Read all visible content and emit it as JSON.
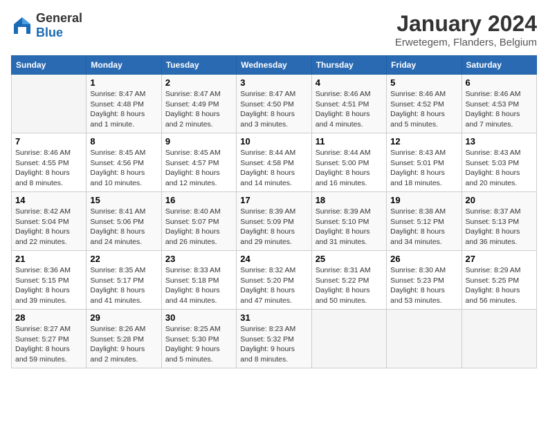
{
  "header": {
    "logo_general": "General",
    "logo_blue": "Blue",
    "month": "January 2024",
    "location": "Erwetegem, Flanders, Belgium"
  },
  "days_of_week": [
    "Sunday",
    "Monday",
    "Tuesday",
    "Wednesday",
    "Thursday",
    "Friday",
    "Saturday"
  ],
  "weeks": [
    [
      {
        "day": "",
        "info": ""
      },
      {
        "day": "1",
        "info": "Sunrise: 8:47 AM\nSunset: 4:48 PM\nDaylight: 8 hours\nand 1 minute."
      },
      {
        "day": "2",
        "info": "Sunrise: 8:47 AM\nSunset: 4:49 PM\nDaylight: 8 hours\nand 2 minutes."
      },
      {
        "day": "3",
        "info": "Sunrise: 8:47 AM\nSunset: 4:50 PM\nDaylight: 8 hours\nand 3 minutes."
      },
      {
        "day": "4",
        "info": "Sunrise: 8:46 AM\nSunset: 4:51 PM\nDaylight: 8 hours\nand 4 minutes."
      },
      {
        "day": "5",
        "info": "Sunrise: 8:46 AM\nSunset: 4:52 PM\nDaylight: 8 hours\nand 5 minutes."
      },
      {
        "day": "6",
        "info": "Sunrise: 8:46 AM\nSunset: 4:53 PM\nDaylight: 8 hours\nand 7 minutes."
      }
    ],
    [
      {
        "day": "7",
        "info": "Sunrise: 8:46 AM\nSunset: 4:55 PM\nDaylight: 8 hours\nand 8 minutes."
      },
      {
        "day": "8",
        "info": "Sunrise: 8:45 AM\nSunset: 4:56 PM\nDaylight: 8 hours\nand 10 minutes."
      },
      {
        "day": "9",
        "info": "Sunrise: 8:45 AM\nSunset: 4:57 PM\nDaylight: 8 hours\nand 12 minutes."
      },
      {
        "day": "10",
        "info": "Sunrise: 8:44 AM\nSunset: 4:58 PM\nDaylight: 8 hours\nand 14 minutes."
      },
      {
        "day": "11",
        "info": "Sunrise: 8:44 AM\nSunset: 5:00 PM\nDaylight: 8 hours\nand 16 minutes."
      },
      {
        "day": "12",
        "info": "Sunrise: 8:43 AM\nSunset: 5:01 PM\nDaylight: 8 hours\nand 18 minutes."
      },
      {
        "day": "13",
        "info": "Sunrise: 8:43 AM\nSunset: 5:03 PM\nDaylight: 8 hours\nand 20 minutes."
      }
    ],
    [
      {
        "day": "14",
        "info": "Sunrise: 8:42 AM\nSunset: 5:04 PM\nDaylight: 8 hours\nand 22 minutes."
      },
      {
        "day": "15",
        "info": "Sunrise: 8:41 AM\nSunset: 5:06 PM\nDaylight: 8 hours\nand 24 minutes."
      },
      {
        "day": "16",
        "info": "Sunrise: 8:40 AM\nSunset: 5:07 PM\nDaylight: 8 hours\nand 26 minutes."
      },
      {
        "day": "17",
        "info": "Sunrise: 8:39 AM\nSunset: 5:09 PM\nDaylight: 8 hours\nand 29 minutes."
      },
      {
        "day": "18",
        "info": "Sunrise: 8:39 AM\nSunset: 5:10 PM\nDaylight: 8 hours\nand 31 minutes."
      },
      {
        "day": "19",
        "info": "Sunrise: 8:38 AM\nSunset: 5:12 PM\nDaylight: 8 hours\nand 34 minutes."
      },
      {
        "day": "20",
        "info": "Sunrise: 8:37 AM\nSunset: 5:13 PM\nDaylight: 8 hours\nand 36 minutes."
      }
    ],
    [
      {
        "day": "21",
        "info": "Sunrise: 8:36 AM\nSunset: 5:15 PM\nDaylight: 8 hours\nand 39 minutes."
      },
      {
        "day": "22",
        "info": "Sunrise: 8:35 AM\nSunset: 5:17 PM\nDaylight: 8 hours\nand 41 minutes."
      },
      {
        "day": "23",
        "info": "Sunrise: 8:33 AM\nSunset: 5:18 PM\nDaylight: 8 hours\nand 44 minutes."
      },
      {
        "day": "24",
        "info": "Sunrise: 8:32 AM\nSunset: 5:20 PM\nDaylight: 8 hours\nand 47 minutes."
      },
      {
        "day": "25",
        "info": "Sunrise: 8:31 AM\nSunset: 5:22 PM\nDaylight: 8 hours\nand 50 minutes."
      },
      {
        "day": "26",
        "info": "Sunrise: 8:30 AM\nSunset: 5:23 PM\nDaylight: 8 hours\nand 53 minutes."
      },
      {
        "day": "27",
        "info": "Sunrise: 8:29 AM\nSunset: 5:25 PM\nDaylight: 8 hours\nand 56 minutes."
      }
    ],
    [
      {
        "day": "28",
        "info": "Sunrise: 8:27 AM\nSunset: 5:27 PM\nDaylight: 8 hours\nand 59 minutes."
      },
      {
        "day": "29",
        "info": "Sunrise: 8:26 AM\nSunset: 5:28 PM\nDaylight: 9 hours\nand 2 minutes."
      },
      {
        "day": "30",
        "info": "Sunrise: 8:25 AM\nSunset: 5:30 PM\nDaylight: 9 hours\nand 5 minutes."
      },
      {
        "day": "31",
        "info": "Sunrise: 8:23 AM\nSunset: 5:32 PM\nDaylight: 9 hours\nand 8 minutes."
      },
      {
        "day": "",
        "info": ""
      },
      {
        "day": "",
        "info": ""
      },
      {
        "day": "",
        "info": ""
      }
    ]
  ]
}
